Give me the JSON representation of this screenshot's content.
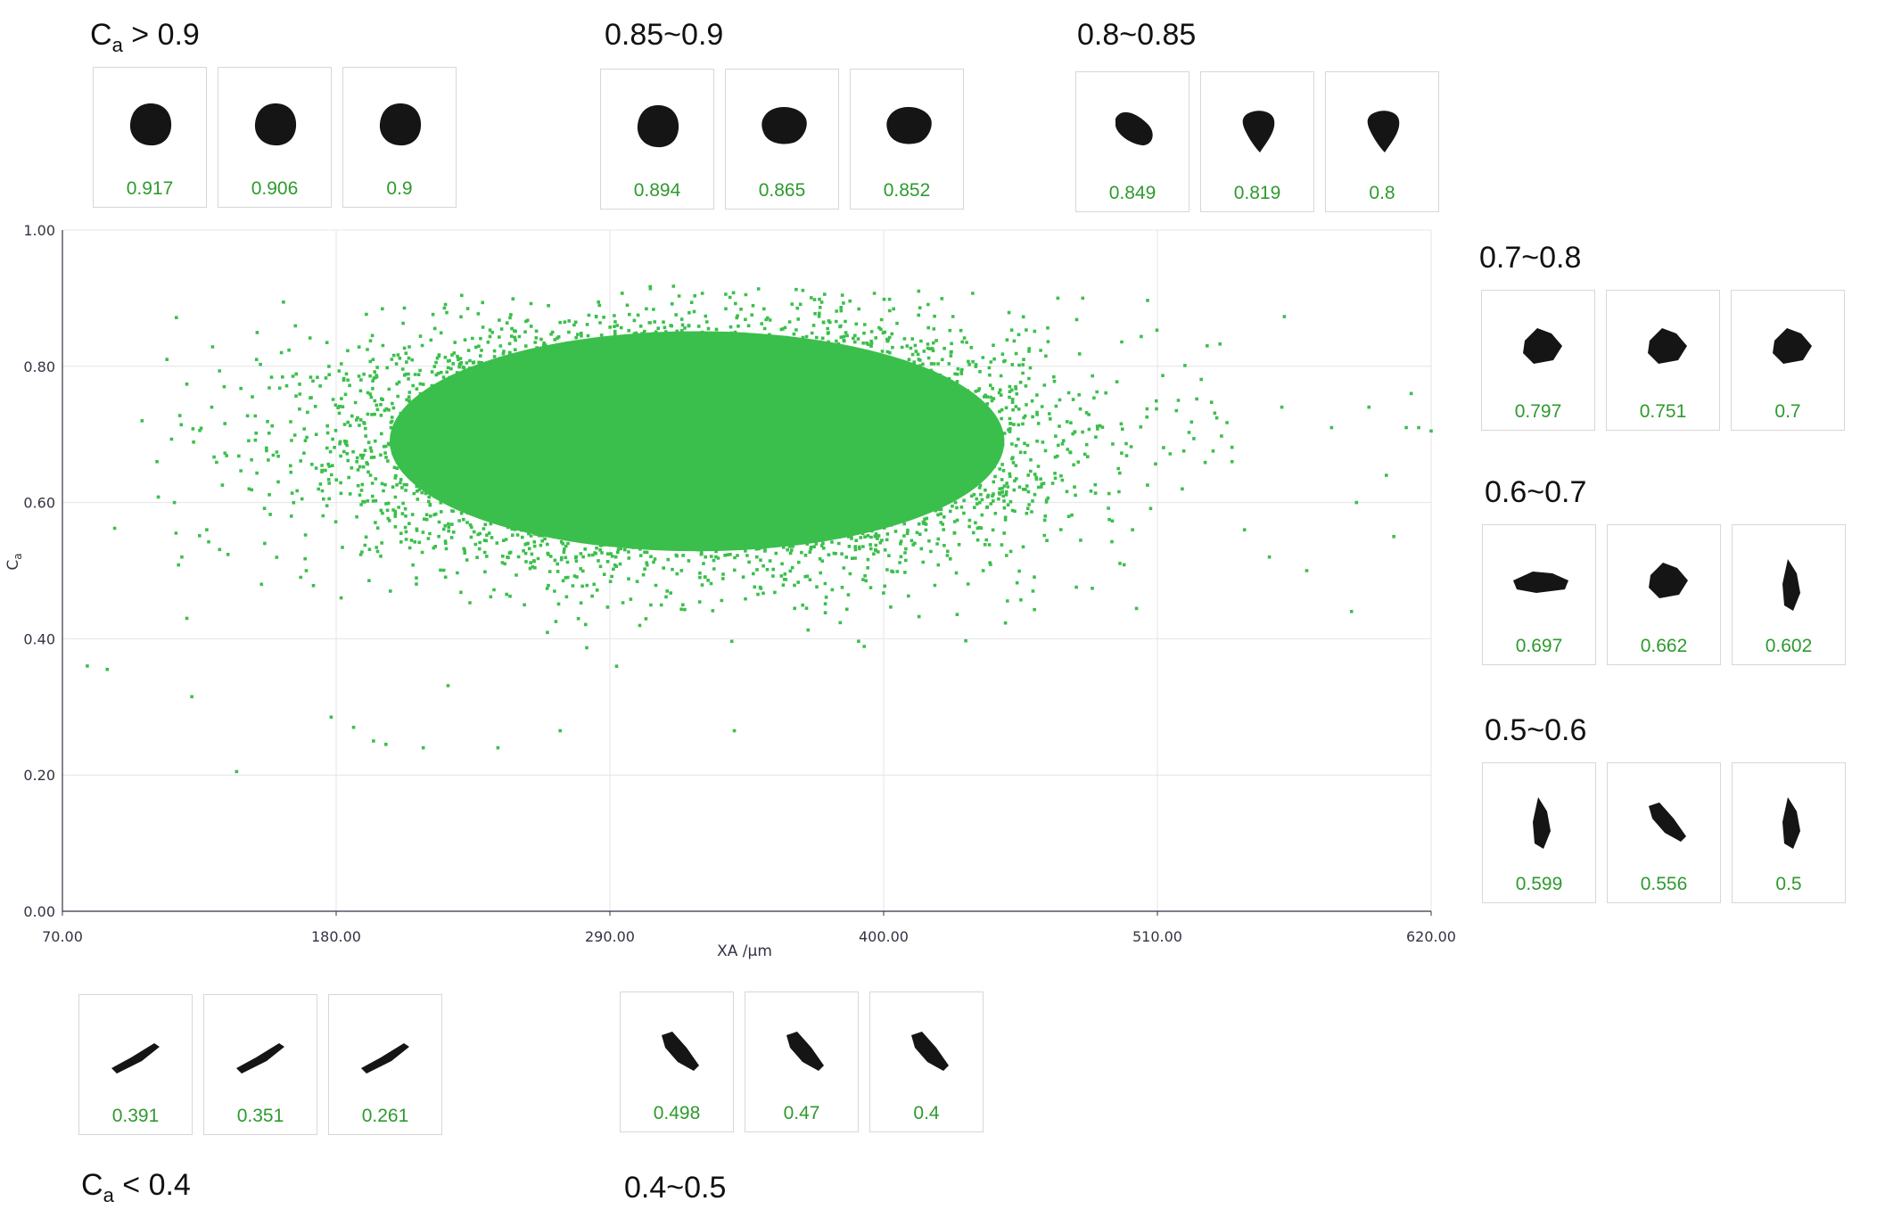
{
  "colors": {
    "point": "#3bbf4c",
    "value_text": "#2e9a2e",
    "axis": "#333344",
    "grid": "#e4e4e4",
    "particle": "#151515"
  },
  "groups": [
    {
      "id": "gt09",
      "label": "0.9",
      "prefix": "> ",
      "items": [
        {
          "value": "0.917",
          "shape": "round"
        },
        {
          "value": "0.906",
          "shape": "round"
        },
        {
          "value": "0.9",
          "shape": "round"
        }
      ]
    },
    {
      "id": "g085",
      "label": "0.85~0.9",
      "items": [
        {
          "value": "0.894",
          "shape": "round"
        },
        {
          "value": "0.865",
          "shape": "blob"
        },
        {
          "value": "0.852",
          "shape": "blob"
        }
      ]
    },
    {
      "id": "g08",
      "label": "0.8~0.85",
      "items": [
        {
          "value": "0.849",
          "shape": "oval"
        },
        {
          "value": "0.819",
          "shape": "drop"
        },
        {
          "value": "0.8",
          "shape": "drop"
        }
      ]
    },
    {
      "id": "g07",
      "label": "0.7~0.8",
      "items": [
        {
          "value": "0.797",
          "shape": "angular"
        },
        {
          "value": "0.751",
          "shape": "angular"
        },
        {
          "value": "0.7",
          "shape": "angular"
        }
      ]
    },
    {
      "id": "g06",
      "label": "0.6~0.7",
      "items": [
        {
          "value": "0.697",
          "shape": "flat"
        },
        {
          "value": "0.662",
          "shape": "angular"
        },
        {
          "value": "0.602",
          "shape": "thin"
        }
      ]
    },
    {
      "id": "g05",
      "label": "0.5~0.6",
      "items": [
        {
          "value": "0.599",
          "shape": "thin"
        },
        {
          "value": "0.556",
          "shape": "elong"
        },
        {
          "value": "0.5",
          "shape": "thin"
        }
      ]
    },
    {
      "id": "glt04",
      "label": "0.4",
      "prefix": "< ",
      "items": [
        {
          "value": "0.391",
          "shape": "needle"
        },
        {
          "value": "0.351",
          "shape": "needle"
        },
        {
          "value": "0.261",
          "shape": "needle"
        }
      ]
    },
    {
      "id": "g04",
      "label": "0.4~0.5",
      "items": [
        {
          "value": "0.498",
          "shape": "elong"
        },
        {
          "value": "0.47",
          "shape": "elong"
        },
        {
          "value": "0.4",
          "shape": "elong"
        }
      ]
    }
  ],
  "symbol": {
    "main": "C",
    "sub": "a"
  },
  "chart_data": {
    "type": "scatter",
    "xlabel": "XA /μm",
    "ylabel": "Ca",
    "xlim": [
      70,
      620
    ],
    "ylim": [
      0,
      1
    ],
    "x_ticks": [
      "70.00",
      "180.00",
      "290.00",
      "400.00",
      "510.00",
      "620.00"
    ],
    "y_ticks": [
      "0.00",
      "0.20",
      "0.40",
      "0.60",
      "0.80",
      "1.00"
    ],
    "grid": true,
    "legend": "none",
    "distribution": {
      "center": [
        325,
        0.69
      ],
      "x_spread": 65,
      "y_spread": 0.085,
      "approx_points": 60000
    },
    "points": [
      [
        80,
        0.36
      ],
      [
        88,
        0.355
      ],
      [
        102,
        0.72
      ],
      [
        108,
        0.66
      ],
      [
        112,
        0.81
      ],
      [
        115,
        0.6
      ],
      [
        118,
        0.52
      ],
      [
        120,
        0.43
      ],
      [
        122,
        0.315
      ],
      [
        128,
        0.56
      ],
      [
        130,
        0.74
      ],
      [
        135,
        0.77
      ],
      [
        140,
        0.205
      ],
      [
        145,
        0.62
      ],
      [
        148,
        0.81
      ],
      [
        150,
        0.48
      ],
      [
        152,
        0.68
      ],
      [
        158,
        0.82
      ],
      [
        162,
        0.58
      ],
      [
        168,
        0.5
      ],
      [
        172,
        0.7
      ],
      [
        178,
        0.285
      ],
      [
        182,
        0.46
      ],
      [
        187,
        0.27
      ],
      [
        190,
        0.78
      ],
      [
        195,
        0.25
      ],
      [
        200,
        0.245
      ],
      [
        215,
        0.24
      ],
      [
        245,
        0.24
      ],
      [
        270,
        0.265
      ],
      [
        340,
        0.265
      ],
      [
        440,
        0.5
      ],
      [
        460,
        0.47
      ],
      [
        470,
        0.9
      ],
      [
        480,
        0.9
      ],
      [
        500,
        0.56
      ],
      [
        520,
        0.62
      ],
      [
        530,
        0.83
      ],
      [
        540,
        0.66
      ],
      [
        545,
        0.56
      ],
      [
        555,
        0.52
      ],
      [
        560,
        0.74
      ],
      [
        570,
        0.5
      ],
      [
        580,
        0.71
      ],
      [
        588,
        0.44
      ],
      [
        590,
        0.6
      ],
      [
        595,
        0.74
      ],
      [
        602,
        0.64
      ],
      [
        605,
        0.55
      ],
      [
        610,
        0.71
      ],
      [
        612,
        0.76
      ],
      [
        615,
        0.71
      ],
      [
        620,
        0.705
      ]
    ]
  }
}
